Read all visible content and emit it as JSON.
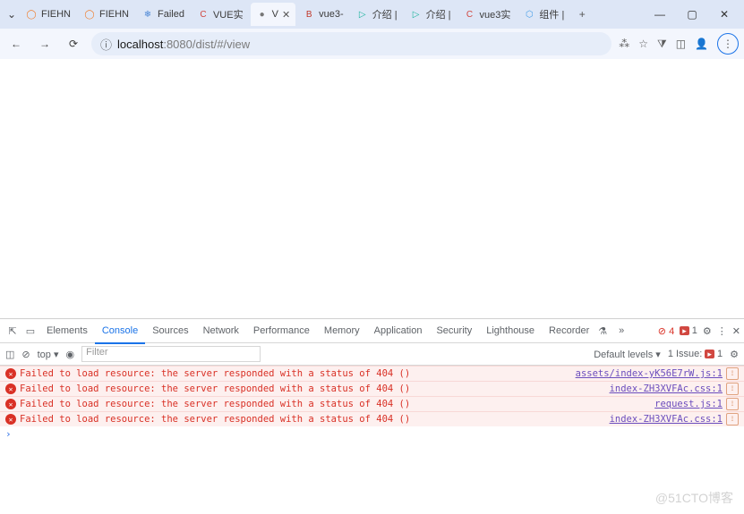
{
  "tabs": [
    {
      "fav": "◯",
      "label": "FIEHN",
      "color": "#f08030"
    },
    {
      "fav": "◯",
      "label": "FIEHN",
      "color": "#f08030"
    },
    {
      "fav": "❄",
      "label": "Failed",
      "color": "#4d88d6"
    },
    {
      "fav": "C",
      "label": "VUE实",
      "color": "#d14841"
    },
    {
      "fav": "●",
      "label": "V",
      "active": true,
      "color": "#777"
    },
    {
      "fav": "B",
      "label": "vue3-",
      "color": "#c0392b"
    },
    {
      "fav": "▷",
      "label": "介绍 |",
      "color": "#19b39c"
    },
    {
      "fav": "▷",
      "label": "介绍 |",
      "color": "#19b39c"
    },
    {
      "fav": "C",
      "label": "vue3实",
      "color": "#d14841"
    },
    {
      "fav": "⬡",
      "label": "组件 |",
      "color": "#49a0e8"
    }
  ],
  "url": {
    "host": "localhost",
    "port": ":8080",
    "path": "/dist/#/view"
  },
  "devtools": {
    "tabs": [
      "Elements",
      "Console",
      "Sources",
      "Network",
      "Performance",
      "Memory",
      "Application",
      "Security",
      "Lighthouse",
      "Recorder"
    ],
    "active": "Console",
    "err_count": "4",
    "warn_count": "1",
    "toolbar": {
      "context": "top ▾",
      "filter_ph": "Filter",
      "levels": "Default levels ▾",
      "issues_label": "1 Issue:",
      "issues_count": "1"
    }
  },
  "errors": [
    {
      "msg": "Failed to load resource: the server responded with a status of 404 ()",
      "src": "assets/index-yK56E7rW.js:1"
    },
    {
      "msg": "Failed to load resource: the server responded with a status of 404 ()",
      "src": "index-ZH3XVFAc.css:1"
    },
    {
      "msg": "Failed to load resource: the server responded with a status of 404 ()",
      "src": "request.js:1"
    },
    {
      "msg": "Failed to load resource: the server responded with a status of 404 ()",
      "src": "index-ZH3XVFAc.css:1"
    }
  ],
  "prompt": "›",
  "watermark": "@51CTO博客"
}
